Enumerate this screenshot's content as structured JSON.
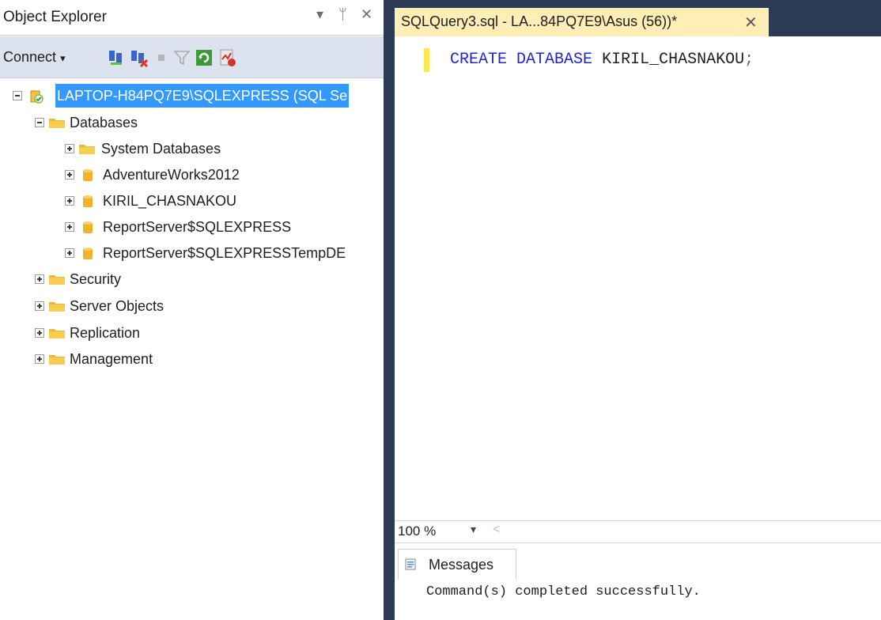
{
  "object_explorer": {
    "title": "Object Explorer",
    "controls": {
      "dropdown_icon": "dropdown-arrow",
      "pin_icon": "pin",
      "close_icon": "close"
    },
    "toolbar": {
      "connect_label": "Connect",
      "buttons": [
        "connect-object-explorer-icon",
        "disconnect-icon",
        "stop-icon",
        "filter-icon",
        "refresh-icon",
        "activity-monitor-icon"
      ]
    },
    "tree": [
      {
        "label": "LAPTOP-H84PQ7E9\\SQLEXPRESS (SQL Se",
        "type": "server",
        "expanded": true,
        "selected": true
      },
      {
        "label": "Databases",
        "type": "folder",
        "expanded": true
      },
      {
        "label": "System Databases",
        "type": "folder",
        "expanded": false
      },
      {
        "label": "AdventureWorks2012",
        "type": "database",
        "expanded": false
      },
      {
        "label": "KIRIL_CHASNAKOU",
        "type": "database",
        "expanded": false
      },
      {
        "label": "ReportServer$SQLEXPRESS",
        "type": "database",
        "expanded": false
      },
      {
        "label": "ReportServer$SQLEXPRESSTempDE",
        "type": "database",
        "expanded": false
      },
      {
        "label": "Security",
        "type": "folder",
        "expanded": false
      },
      {
        "label": "Server Objects",
        "type": "folder",
        "expanded": false
      },
      {
        "label": "Replication",
        "type": "folder",
        "expanded": false
      },
      {
        "label": "Management",
        "type": "folder",
        "expanded": false
      }
    ]
  },
  "editor": {
    "tab_title": "SQLQuery3.sql - LA...84PQ7E9\\Asus (56))*",
    "code": {
      "kw1": "CREATE",
      "kw2": "DATABASE",
      "ident": "KIRIL_CHASNAKOU",
      "punct": ";"
    },
    "zoom": "100 %",
    "results": {
      "tab_label": "Messages",
      "message": "Command(s) completed successfully."
    }
  },
  "colors": {
    "selection": "#3399ff",
    "active_tab": "#ffeeb5",
    "dark_chrome": "#2b3a55",
    "keyword": "#1f24d6"
  }
}
